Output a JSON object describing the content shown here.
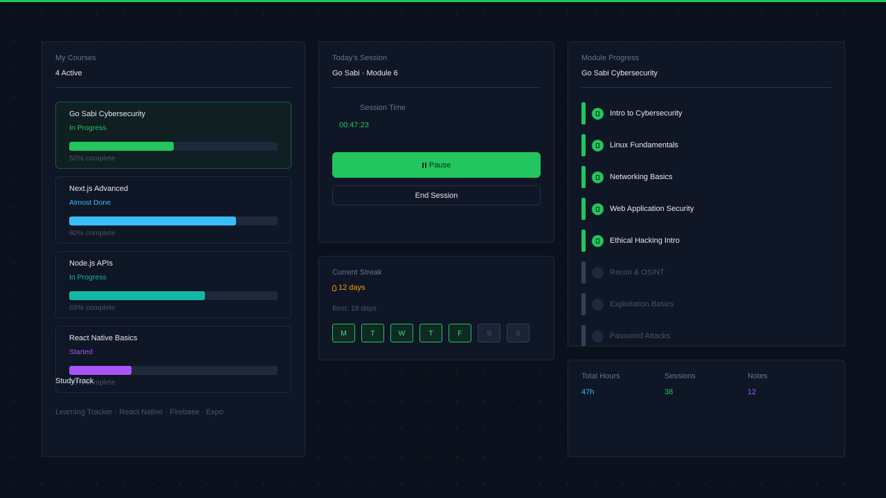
{
  "colors": {
    "accent_green": "#22c55e",
    "accent_blue": "#38bdf8",
    "accent_teal": "#14b8a6",
    "accent_purple": "#a855f7",
    "accent_amber": "#f59e0b"
  },
  "courses_card": {
    "label": "My Courses",
    "count": "4 Active",
    "courses": [
      {
        "name": "Go Sabi Cybersecurity",
        "status": "In Progress",
        "progress": 50,
        "progress_label": "50% complete",
        "color": "#22c55e",
        "status_color": "#22c55e",
        "active": true
      },
      {
        "name": "Next.js Advanced",
        "status": "Almost Done",
        "progress": 80,
        "progress_label": "80% complete",
        "color": "#38bdf8",
        "status_color": "#38bdf8",
        "active": false
      },
      {
        "name": "Node.js APIs",
        "status": "In Progress",
        "progress": 65,
        "progress_label": "65% complete",
        "color": "#14b8a6",
        "status_color": "#14b8a6",
        "active": false
      },
      {
        "name": "React Native Basics",
        "status": "Started",
        "progress": 30,
        "progress_label": "30% complete",
        "color": "#a855f7",
        "status_color": "#a855f7",
        "active": false
      }
    ],
    "brand": "StudyTrack",
    "tagline": "Learning Tracker · React Native · Firebase · Expo"
  },
  "session_card": {
    "label": "Today's Session",
    "module": "Go Sabi · Module 6",
    "time_label": "Session Time",
    "timer": "00:47:23",
    "pause_icon": "pause-icon",
    "pause_label": "Pause",
    "end_label": "End Session"
  },
  "streak_card": {
    "label": "Current Streak",
    "flame_icon": "flame-icon",
    "value": "12 days",
    "best": "Best: 18 days",
    "days": [
      {
        "letter": "M",
        "on": true
      },
      {
        "letter": "T",
        "on": true
      },
      {
        "letter": "W",
        "on": true
      },
      {
        "letter": "T",
        "on": true
      },
      {
        "letter": "F",
        "on": true
      },
      {
        "letter": "S",
        "on": false
      },
      {
        "letter": "S",
        "on": false
      }
    ]
  },
  "module_card": {
    "label": "Module Progress",
    "course": "Go Sabi Cybersecurity",
    "check_icon": "check-icon",
    "modules": [
      {
        "name": "Intro to Cybersecurity",
        "done": true
      },
      {
        "name": "Linux Fundamentals",
        "done": true
      },
      {
        "name": "Networking Basics",
        "done": true
      },
      {
        "name": "Web Application Security",
        "done": true
      },
      {
        "name": "Ethical Hacking Intro",
        "done": true
      },
      {
        "name": "Recon & OSINT",
        "done": false
      },
      {
        "name": "Exploitation Basics",
        "done": false
      },
      {
        "name": "Password Attacks",
        "done": false
      }
    ]
  },
  "stats_card": {
    "stats": [
      {
        "label": "Total Hours",
        "value": "47h",
        "color": "#38bdf8"
      },
      {
        "label": "Sessions",
        "value": "38",
        "color": "#22c55e"
      },
      {
        "label": "Notes",
        "value": "12",
        "color": "#a855f7"
      }
    ]
  }
}
